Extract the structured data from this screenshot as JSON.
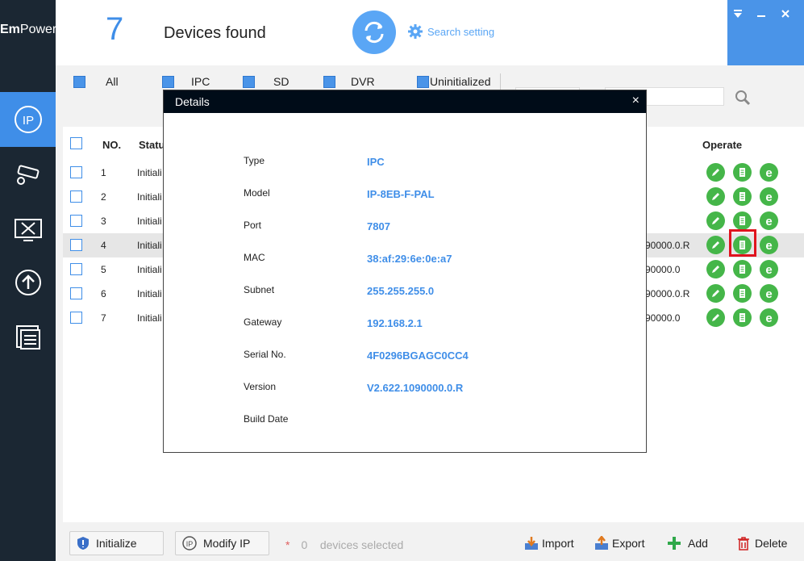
{
  "app": {
    "logo_prefix": "Em",
    "logo_suffix": "Power"
  },
  "header": {
    "device_count": "7",
    "found_label": "Devices found",
    "search_setting_label": "Search setting"
  },
  "filters": [
    {
      "label": "All",
      "checked": true
    },
    {
      "label": "IPC",
      "checked": true
    },
    {
      "label": "SD",
      "checked": true
    },
    {
      "label": "DVR",
      "checked": true
    },
    {
      "label": "Uninitialized",
      "checked": true
    }
  ],
  "table": {
    "headers": {
      "no": "NO.",
      "status": "Status",
      "operate": "Operate"
    },
    "rows": [
      {
        "no": "1",
        "status": "Initiali",
        "tail": ""
      },
      {
        "no": "2",
        "status": "Initiali",
        "tail": ""
      },
      {
        "no": "3",
        "status": "Initiali",
        "tail": ""
      },
      {
        "no": "4",
        "status": "Initiali",
        "tail": "90000.0.R"
      },
      {
        "no": "5",
        "status": "Initiali",
        "tail": "90000.0"
      },
      {
        "no": "6",
        "status": "Initiali",
        "tail": "90000.0.R"
      },
      {
        "no": "7",
        "status": "Initiali",
        "tail": "90000.0"
      }
    ],
    "selected_row": 3
  },
  "dialog": {
    "title": "Details",
    "close": "×",
    "fields": [
      {
        "label": "Type",
        "value": "IPC"
      },
      {
        "label": "Model",
        "value": "IP-8EB-F-PAL"
      },
      {
        "label": "Port",
        "value": "7807"
      },
      {
        "label": "MAC",
        "value": "38:af:29:6e:0e:a7"
      },
      {
        "label": "Subnet",
        "value": "255.255.255.0"
      },
      {
        "label": "Gateway",
        "value": "192.168.2.1"
      },
      {
        "label": "Serial No.",
        "value": "4F0296BGAGC0CC4"
      },
      {
        "label": "Version",
        "value": "V2.622.1090000.0.R"
      },
      {
        "label": "Build Date",
        "value": ""
      }
    ]
  },
  "footer": {
    "initialize_label": "Initialize",
    "modify_ip_label": "Modify IP",
    "star": "*",
    "selected_count": "0",
    "selected_label": "devices selected",
    "import_label": "Import",
    "export_label": "Export",
    "add_label": "Add",
    "delete_label": "Delete"
  },
  "colors": {
    "accent": "#3f8ee8",
    "sidebar": "#1b2733",
    "operate_green": "#45b649",
    "highlight_red": "#e0141e"
  },
  "icons": [
    "ip-icon",
    "camera-icon",
    "tools-icon",
    "upgrade-icon",
    "docs-icon",
    "refresh-icon",
    "gear-icon",
    "magnify-icon",
    "edit-icon",
    "details-icon",
    "browser-icon",
    "shield-icon",
    "import-icon",
    "export-icon",
    "plus-icon",
    "trash-icon"
  ]
}
